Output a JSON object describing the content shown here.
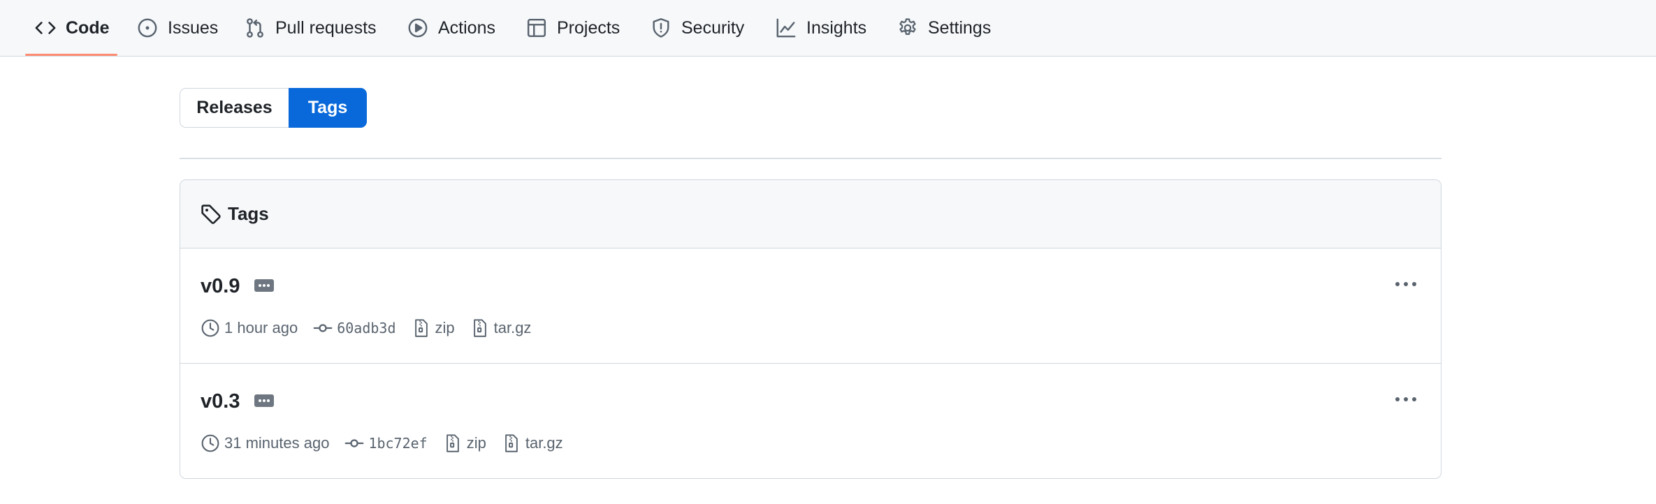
{
  "nav": {
    "items": [
      {
        "label": "Code",
        "icon": "code-icon",
        "selected": true
      },
      {
        "label": "Issues",
        "icon": "issue-opened-icon"
      },
      {
        "label": "Pull requests",
        "icon": "git-pull-request-icon"
      },
      {
        "label": "Actions",
        "icon": "play-icon"
      },
      {
        "label": "Projects",
        "icon": "table-icon"
      },
      {
        "label": "Security",
        "icon": "shield-icon"
      },
      {
        "label": "Insights",
        "icon": "graph-icon"
      },
      {
        "label": "Settings",
        "icon": "gear-icon"
      }
    ],
    "accent_color": "#fd8c73"
  },
  "segmented": {
    "releases_label": "Releases",
    "tags_label": "Tags",
    "selected": "Tags",
    "selected_color": "#0969da"
  },
  "tags_box": {
    "title": "Tags",
    "tags": [
      {
        "name": "v0.9",
        "time": "1 hour ago",
        "sha": "60adb3d",
        "zip": "zip",
        "targz": "tar.gz"
      },
      {
        "name": "v0.3",
        "time": "31 minutes ago",
        "sha": "1bc72ef",
        "zip": "zip",
        "targz": "tar.gz"
      }
    ]
  }
}
